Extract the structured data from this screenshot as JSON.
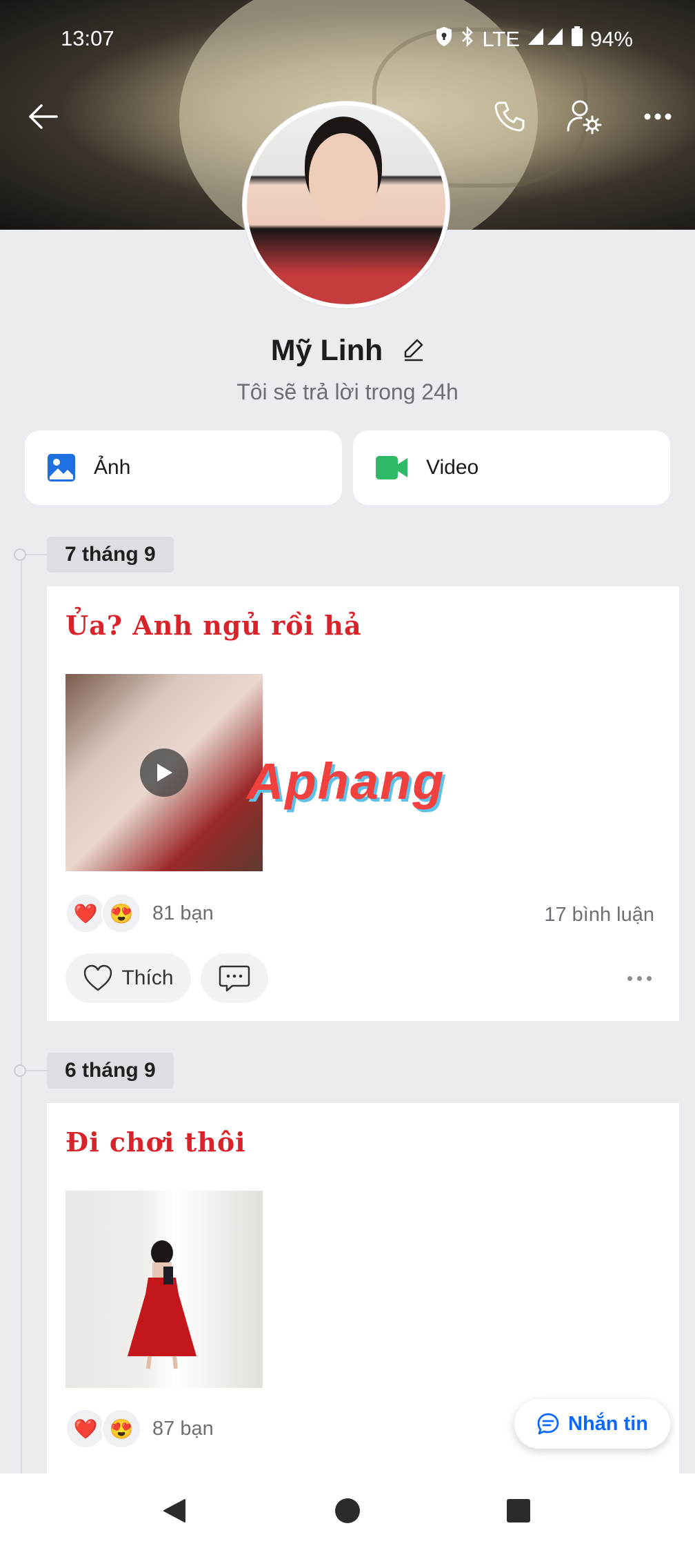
{
  "status_bar": {
    "time": "13:07",
    "network": "LTE",
    "battery": "94%"
  },
  "profile": {
    "name": "Mỹ Linh",
    "subtitle": "Tôi sẽ trả lời trong 24h"
  },
  "media_buttons": {
    "photos": "Ảnh",
    "video": "Video"
  },
  "posts": [
    {
      "date": "7 tháng 9",
      "title": "Ủa? Anh ngủ rồi hả",
      "media": "video",
      "reaction_count": "81 bạn",
      "comment_count": "17 bình luận",
      "like_label": "Thích"
    },
    {
      "date": "6 tháng 9",
      "title": "Đi chơi thôi",
      "media": "photo",
      "reaction_count": "87 bạn"
    }
  ],
  "watermark": "Aphang",
  "message_button": "Nhắn tin",
  "colors": {
    "accent": "#0a68ff",
    "post_title": "#d9232b",
    "photo_icon": "#1e6fe0",
    "video_icon": "#2fb865"
  }
}
